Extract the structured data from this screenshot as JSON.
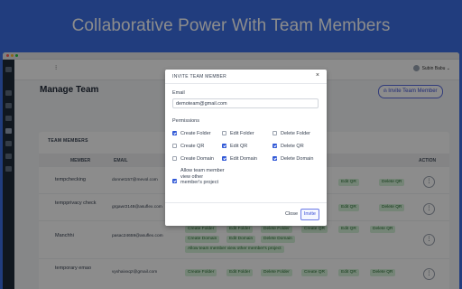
{
  "headline": "Collaborative Power With Team Members",
  "app": {
    "collapse_icon": "⁝",
    "user_name": "Subin Babu ⌄",
    "page_title": "Manage Team",
    "invite_button": "Invite Team Member",
    "card_title": "TEAM MEMBERS",
    "columns": {
      "member": "MEMBER",
      "email": "EMAIL",
      "action": "ACTION"
    },
    "rows": [
      {
        "member": "tempchecking",
        "email": "donnet157@mevol.com",
        "tags": [
          "Create Folder",
          "Edit Folder",
          "Delete Folder",
          "Create QR",
          "Edit QR",
          "Delete QR"
        ]
      },
      {
        "member": "tempprivacy check",
        "email": "grgawr2148@asuflex.com",
        "tags": [
          "Create Folder",
          "Edit Folder",
          "Delete Folder",
          "Create QR",
          "Edit QR",
          "Delete QR"
        ]
      },
      {
        "member": "Manchhi",
        "email": "pasac24659@asuflex.com",
        "tags": [
          "Create Folder",
          "Edit Folder",
          "Delete Folder",
          "Create QR",
          "Edit QR",
          "Delete QR",
          "Create Domain",
          "Edit Domain",
          "Delete Domain",
          "Allow team member view other member's project"
        ]
      },
      {
        "member": "temporary emao",
        "email": "vyxhaivxqz@gmail.com",
        "tags": [
          "Create Folder",
          "Edit Folder",
          "Delete Folder",
          "Create QR",
          "Edit QR",
          "Delete QR"
        ]
      }
    ],
    "action_glyph": "⋮"
  },
  "modal": {
    "title": "INVITE TEAM MEMBER",
    "close_glyph": "×",
    "email_label": "Email",
    "email_value": "demoteam@gmail.com",
    "permissions_label": "Permissions",
    "permissions": [
      {
        "label": "Create Folder",
        "checked": true
      },
      {
        "label": "Edit Folder",
        "checked": false
      },
      {
        "label": "Delete Folder",
        "checked": false
      },
      {
        "label": "Create QR",
        "checked": false
      },
      {
        "label": "Edit QR",
        "checked": true
      },
      {
        "label": "Delete QR",
        "checked": true
      },
      {
        "label": "Create Domain",
        "checked": false
      },
      {
        "label": "Edit Domain",
        "checked": true
      },
      {
        "label": "Delete Domain",
        "checked": true
      }
    ],
    "allow_view": {
      "label": "Allow team member view other member's project",
      "checked": true
    },
    "close_button": "Close",
    "invite_button": "Invite"
  },
  "colors": {
    "background": "#3c70e6",
    "accent": "#2f57d6",
    "tag_bg": "#d6f3d9",
    "tag_text": "#236b2d"
  }
}
